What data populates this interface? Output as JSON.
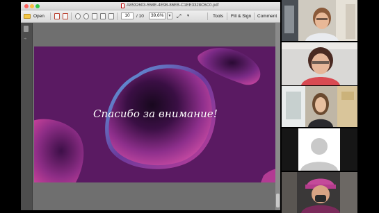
{
  "window": {
    "title": "A8532603-558E-4E98-86EB-C1EE3328C6C0.pdf"
  },
  "toolbar": {
    "open_label": "Open",
    "page_current": "10",
    "page_total": "/ 10",
    "zoom": "39,6%",
    "tools_label": "Tools",
    "fill_sign_label": "Fill & Sign",
    "comment_label": "Comment"
  },
  "slide": {
    "text": "Спасибо за внимание!",
    "background": "#5a1a62",
    "accent_colors": [
      "#c23a9a",
      "#3a7fc1",
      "#7b2f8f"
    ]
  },
  "participants": {
    "tiles": [
      {
        "name": "participant-1",
        "kind": "video"
      },
      {
        "name": "participant-2",
        "kind": "video"
      },
      {
        "name": "participant-3",
        "kind": "video"
      },
      {
        "name": "participant-4",
        "kind": "avatar-placeholder"
      },
      {
        "name": "participant-5",
        "kind": "video"
      }
    ]
  },
  "icons": [
    "folder-icon",
    "create-pdf-icon",
    "combine-icon",
    "page-up-icon",
    "page-down-icon",
    "save-icon",
    "print-icon",
    "email-icon",
    "rotate-icon",
    "pages-panel-icon",
    "attachment-icon",
    "default-avatar-icon"
  ]
}
